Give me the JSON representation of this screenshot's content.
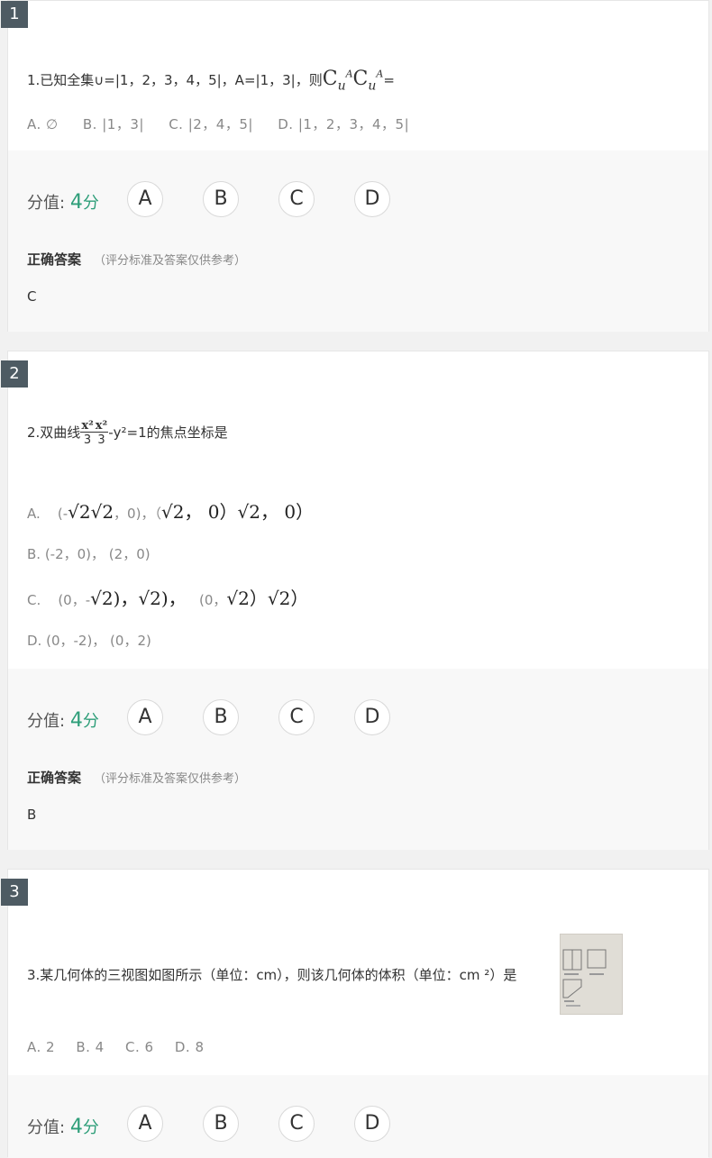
{
  "questions": [
    {
      "number": "1",
      "stem_text": "1.已知全集∪=|1，2，3，4，5|，A=|1，3|，则",
      "stem_math": "C",
      "stem_sub": "u",
      "stem_sup": "A",
      "stem_math2": "C",
      "stem_sub2": "u",
      "stem_sup2": "A",
      "stem_end": "=",
      "options_line": [
        "A.  ∅",
        "B.  |1，3|",
        "C.  |2，4，5|",
        "D.  |1，2，3，4，5|"
      ],
      "score_label": "分值:",
      "score_value": "4",
      "score_unit": "分",
      "choices": [
        "A",
        "B",
        "C",
        "D"
      ],
      "answer_title": "正确答案",
      "answer_note": "（评分标准及答案仅供参考）",
      "answer": "C"
    },
    {
      "number": "2",
      "stem_pre": "2.双曲线",
      "frac1_num": "x²",
      "frac1_den": "3",
      "frac2_num": "x²",
      "frac2_den": "3",
      "stem_post": "-y²=1的焦点坐标是",
      "optA_label": "A.",
      "optA_pre": "(-",
      "optA_math1": "√2√2",
      "optA_mid": "，0)，（",
      "optA_math2": "√2， 0）√2， 0）",
      "optB": "B.    (-2，0)，  (2，0)",
      "optC_label": "C.",
      "optC_pre": "(0，-",
      "optC_math1": "√2)，√2)，",
      "optC_mid": "(0，",
      "optC_math2": "√2）√2）",
      "optD": "D.    (0，-2)，  (0，2)",
      "score_label": "分值:",
      "score_value": "4",
      "score_unit": "分",
      "choices": [
        "A",
        "B",
        "C",
        "D"
      ],
      "answer_title": "正确答案",
      "answer_note": "（评分标准及答案仅供参考）",
      "answer": "B"
    },
    {
      "number": "3",
      "stem_text": "3.某几何体的三视图如图所示（单位：cm），则该几何体的体积（单位：cm ²）是",
      "options_line": [
        "A.  2",
        "B.  4",
        "C.  6",
        "D.  8"
      ],
      "score_label": "分值:",
      "score_value": "4",
      "score_unit": "分",
      "choices": [
        "A",
        "B",
        "C",
        "D"
      ]
    }
  ],
  "colors": {
    "badge": "#4e5b63",
    "score": "#2e9e79",
    "panel": "#f8f8f8"
  }
}
